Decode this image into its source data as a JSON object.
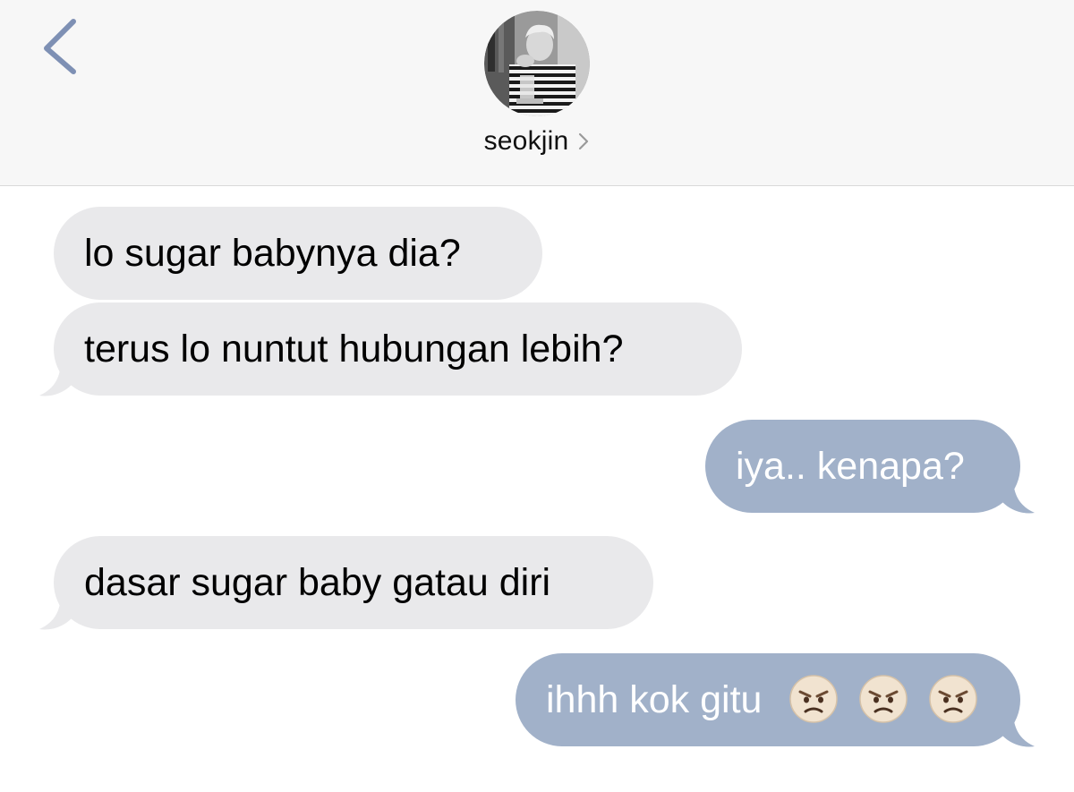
{
  "header": {
    "contact_name": "seokjin",
    "avatar": {
      "description_icon": "contact-photo"
    }
  },
  "messages": [
    {
      "direction": "incoming",
      "text": "lo sugar babynya dia?"
    },
    {
      "direction": "incoming",
      "text": "terus lo nuntut hubungan lebih?"
    },
    {
      "direction": "outgoing",
      "text": "iya.. kenapa?"
    },
    {
      "direction": "incoming",
      "text": "dasar sugar baby gatau diri"
    },
    {
      "direction": "outgoing",
      "text": "ihhh kok gitu",
      "emojis": [
        "angry-face-icon",
        "angry-face-icon",
        "angry-face-icon"
      ]
    }
  ],
  "colors": {
    "incoming_bubble": "#e9e9eb",
    "outgoing_bubble": "#a1b1c9",
    "back_chevron": "#7e90b4",
    "header_bg": "#f7f7f7"
  }
}
